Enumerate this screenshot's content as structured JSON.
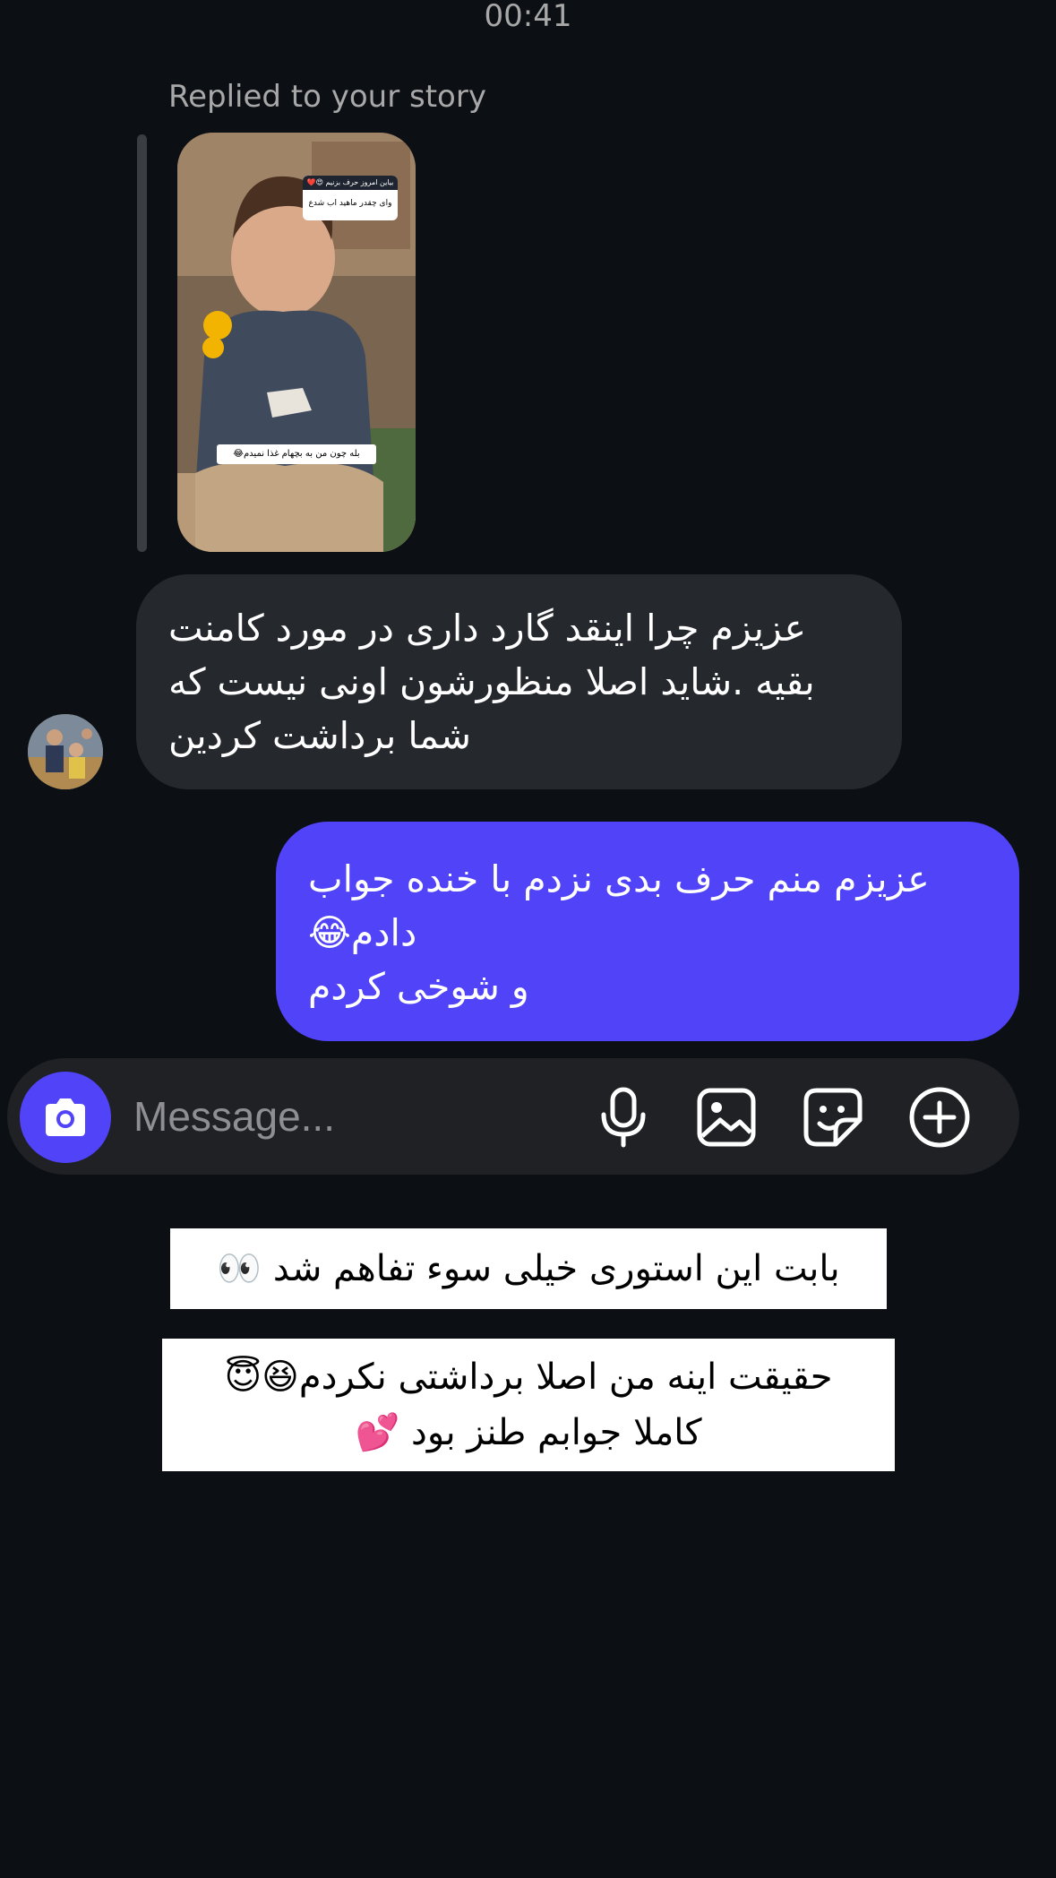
{
  "header": {
    "timestamp": "00:41"
  },
  "story_reply": {
    "label": "Replied to your story",
    "overlay_top_line": "بیاین امروز حرف بزنیم 😍❤️",
    "overlay_question": "وای چقدر ماهید اب شدع",
    "overlay_answer": "بله چون من به بچهام غذا نمیدم😂"
  },
  "messages": [
    {
      "direction": "incoming",
      "lines": [
        "عزیزم چرا اینقد گارد داری در مورد کامنت",
        "بقیه .شاید اصلا منظورشون اونی نیست که",
        "شما برداشت کردین"
      ]
    },
    {
      "direction": "outgoing",
      "lines": [
        "عزیزم منم حرف بدی نزدم با خنده جواب",
        "دادم😂",
        "و شوخی کردم"
      ]
    }
  ],
  "composer": {
    "placeholder": "Message...",
    "icons": [
      "camera-icon",
      "microphone-icon",
      "gallery-icon",
      "sticker-icon",
      "plus-circle-icon"
    ]
  },
  "captions": [
    [
      "بابت این استوری خیلی سوء تفاهم شد 👀"
    ],
    [
      "حقیقت اینه من اصلا برداشتی نکردم😆😇",
      "کاملا جوابم طنز بود 💕"
    ]
  ],
  "colors": {
    "background": "#0c1014",
    "incoming_bubble": "#25282d",
    "outgoing_bubble": "#5143f7",
    "composer": "#1f2125",
    "muted_text": "#a8a8a8"
  }
}
